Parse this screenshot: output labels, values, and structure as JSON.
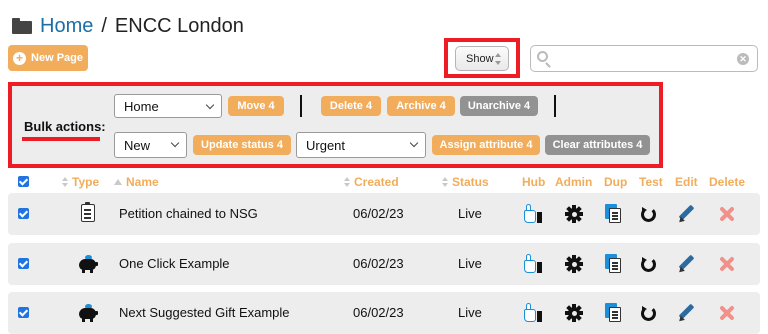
{
  "title": {
    "home": "Home",
    "separator": "/",
    "site": "ENCC London"
  },
  "toolbar": {
    "new_page_label": "New Page",
    "show_label": "Show"
  },
  "search": {
    "value": "",
    "placeholder": ""
  },
  "bulk": {
    "label": "Bulk actions:",
    "page_select": "Home",
    "move_label": "Move 4",
    "delete_label": "Delete 4",
    "archive_label": "Archive 4",
    "unarchive_label": "Unarchive 4",
    "status_select": "New",
    "update_status_label": "Update status 4",
    "attribute_select": "Urgent",
    "assign_attribute_label": "Assign attribute 4",
    "clear_attributes_label": "Clear attributes 4"
  },
  "columns": {
    "type": "Type",
    "name": "Name",
    "created": "Created",
    "status": "Status",
    "hub": "Hub",
    "admin": "Admin",
    "dup": "Dup",
    "test": "Test",
    "edit": "Edit",
    "delete": "Delete"
  },
  "rows": [
    {
      "type_icon": "petition-icon",
      "name": "Petition chained to NSG",
      "created": "06/02/23",
      "status": "Live"
    },
    {
      "type_icon": "piggy-bank-icon",
      "name": "One Click Example",
      "created": "06/02/23",
      "status": "Live"
    },
    {
      "type_icon": "piggy-bank-icon",
      "name": "Next Suggested Gift Example",
      "created": "06/02/23",
      "status": "Live"
    }
  ],
  "colors": {
    "accent_orange": "#f1ad5c",
    "button_grey": "#929292",
    "highlight_red": "#ee1c24",
    "link_blue": "#1b6fa8",
    "checkbox_blue": "#1f74e0"
  }
}
